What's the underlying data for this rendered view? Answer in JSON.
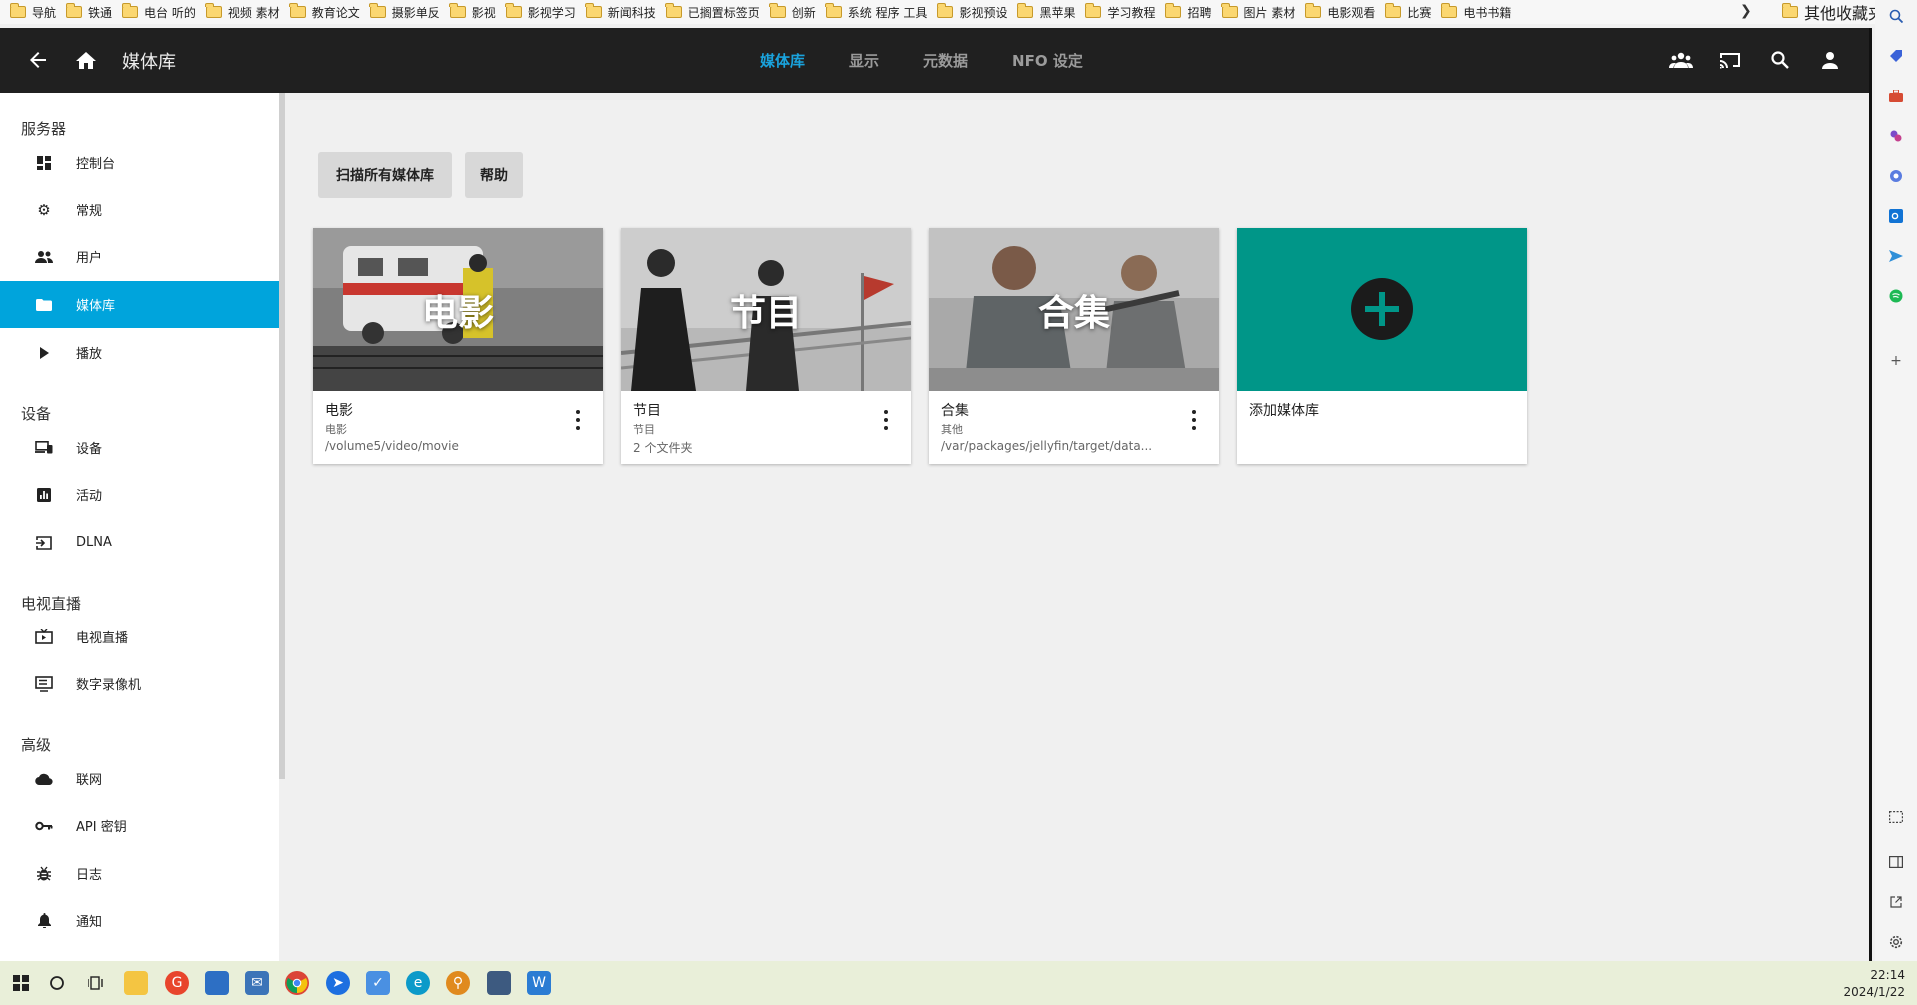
{
  "bookmarks": {
    "items": [
      "导航",
      "铁通",
      "电台 听的",
      "视频 素材",
      "教育论文",
      "摄影单反",
      "影视",
      "影视学习",
      "新闻科技",
      "已搁置标签页",
      "创新",
      "系统 程序 工具",
      "影视预设",
      "黑苹果",
      "学习教程",
      "招聘",
      "图片 素材",
      "电影观看",
      "比赛",
      "电书书籍"
    ],
    "more_icon": "chevron-right",
    "other": "其他收藏夹"
  },
  "topbar": {
    "title": "媒体库",
    "tabs": [
      "媒体库",
      "显示",
      "元数据",
      "NFO 设定"
    ],
    "active_tab": 0,
    "accent": "#1aa3dd"
  },
  "sidebar": {
    "sections": [
      {
        "title": "服务器",
        "items": [
          {
            "label": "控制台",
            "icon": "dashboard-icon"
          },
          {
            "label": "常规",
            "icon": "gear-icon"
          },
          {
            "label": "用户",
            "icon": "users-icon"
          },
          {
            "label": "媒体库",
            "icon": "folder-icon",
            "active": true
          },
          {
            "label": "播放",
            "icon": "play-icon"
          }
        ]
      },
      {
        "title": "设备",
        "items": [
          {
            "label": "设备",
            "icon": "devices-icon"
          },
          {
            "label": "活动",
            "icon": "activity-icon"
          },
          {
            "label": "DLNA",
            "icon": "input-icon"
          }
        ]
      },
      {
        "title": "电视直播",
        "items": [
          {
            "label": "电视直播",
            "icon": "live-tv-icon"
          },
          {
            "label": "数字录像机",
            "icon": "dvr-icon"
          }
        ]
      },
      {
        "title": "高级",
        "items": [
          {
            "label": "联网",
            "icon": "cloud-icon"
          },
          {
            "label": "API 密钥",
            "icon": "key-icon"
          },
          {
            "label": "日志",
            "icon": "bug-icon"
          },
          {
            "label": "通知",
            "icon": "bell-icon"
          }
        ]
      }
    ],
    "active_color": "#00a4dc"
  },
  "main": {
    "scan_button": "扫描所有媒体库",
    "help_button": "帮助",
    "libraries": [
      {
        "overlay": "电影",
        "name": "电影",
        "type": "电影",
        "path": "/volume5/video/movie"
      },
      {
        "overlay": "节目",
        "name": "节目",
        "type": "节目",
        "path": "2 个文件夹"
      },
      {
        "overlay": "合集",
        "name": "合集",
        "type": "其他",
        "path": "/var/packages/jellyfin/target/data..."
      }
    ],
    "add_library": "添加媒体库",
    "add_color": "#009688"
  },
  "taskbar": {
    "time": "22:14",
    "date": "2024/1/22"
  }
}
